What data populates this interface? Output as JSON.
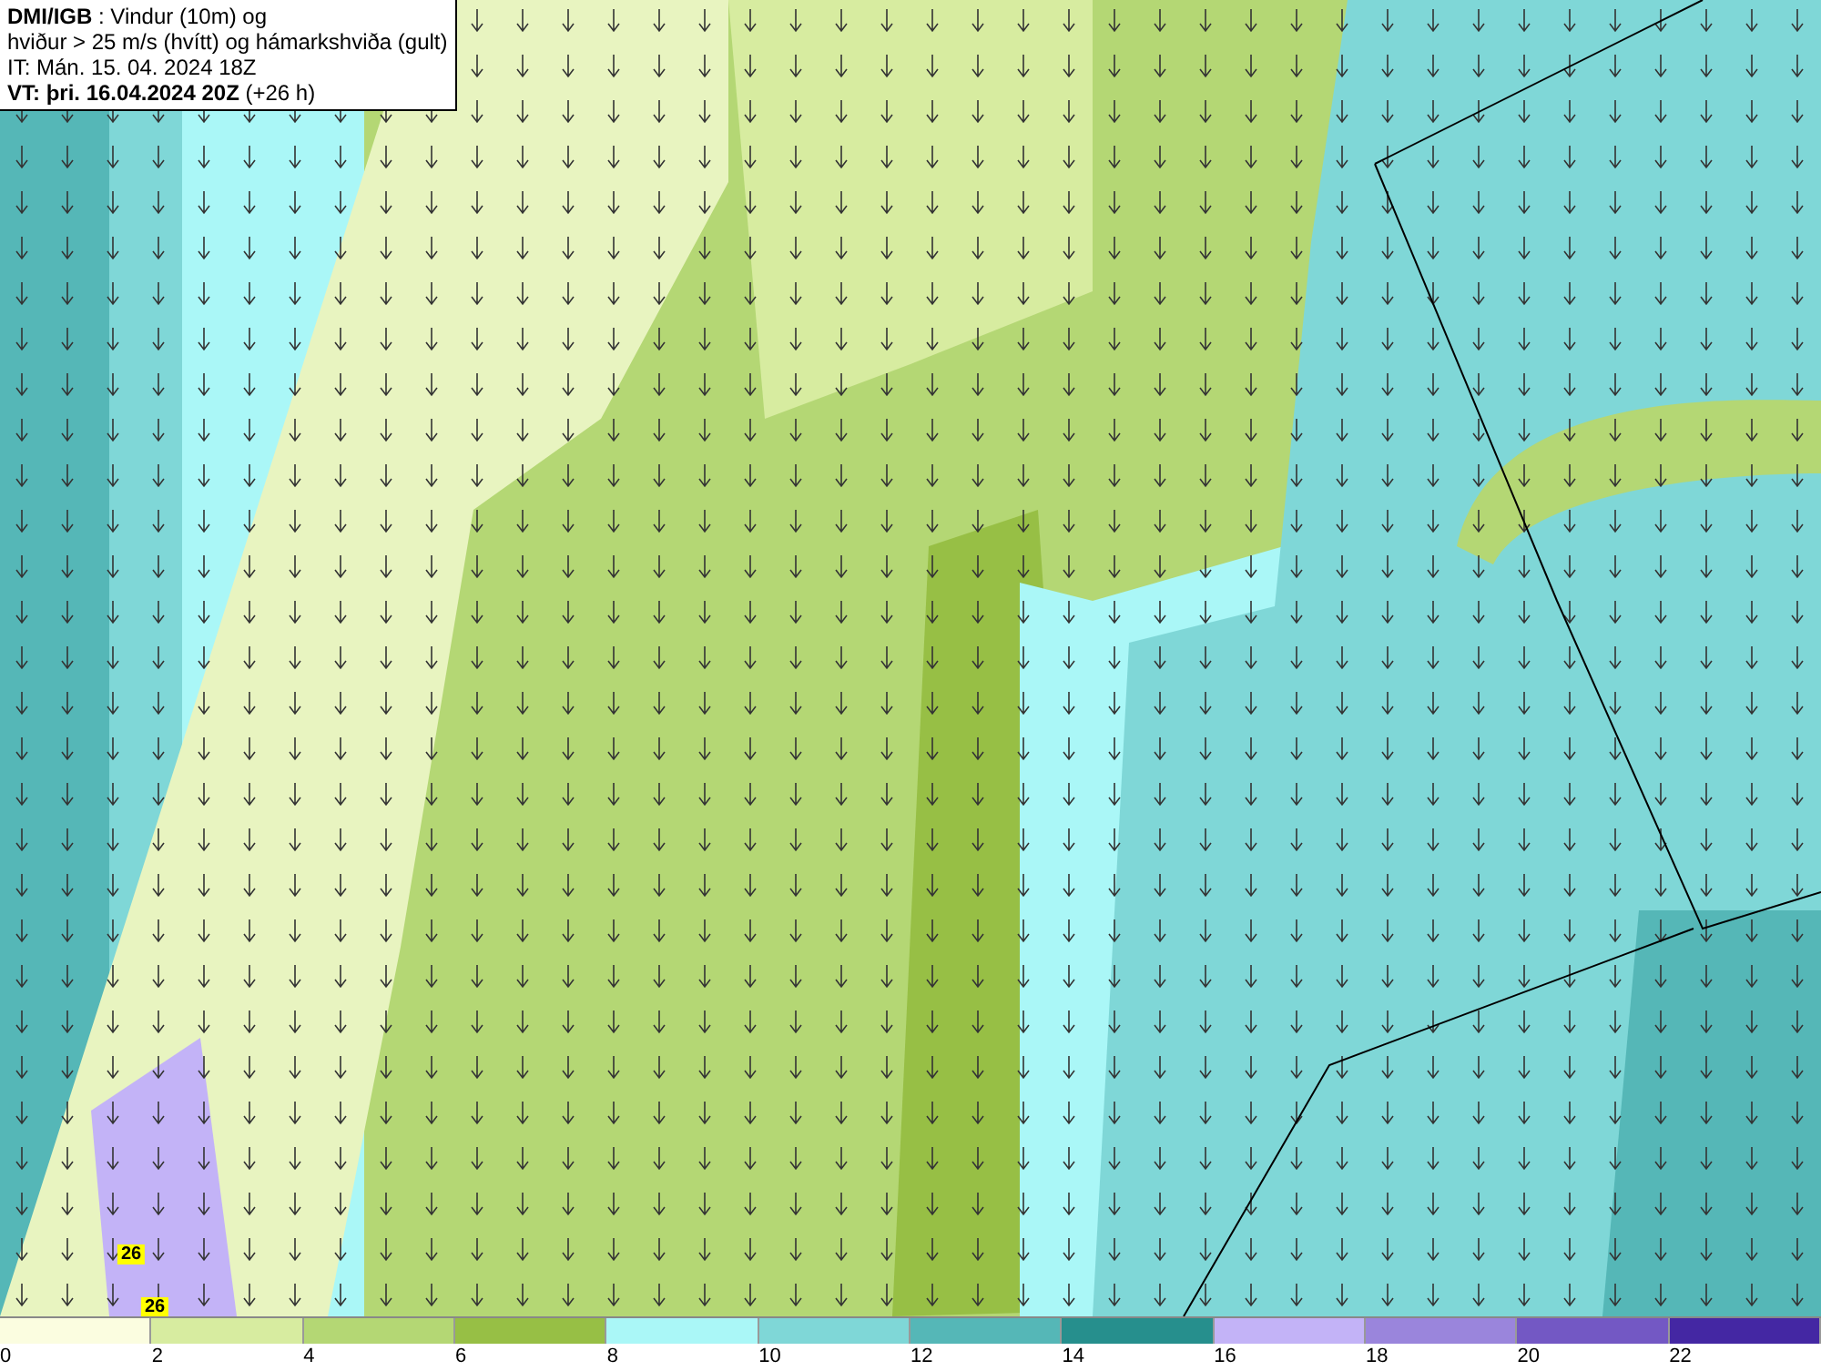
{
  "title_box": {
    "lines": [
      "**DMI/IGB** : Vindur (10m) og",
      "hviður > 25 m/s (hvítt) og hámarkshviða (gult)",
      "IT: Mán. 15. 04. 2024 18Z",
      "**VT: þri. 16.04.2024 20Z** (+26 h)"
    ]
  },
  "map": {
    "gust_labels": [
      "26",
      "26"
    ]
  },
  "legend": {
    "bins": [
      {
        "color": "#fbfde0"
      },
      {
        "color": "#d7eca0"
      },
      {
        "color": "#b4d774"
      },
      {
        "color": "#97bf45"
      },
      {
        "color": "#aaf7f7"
      },
      {
        "color": "#7fd7d7"
      },
      {
        "color": "#55b7b7"
      },
      {
        "color": "#268f8d"
      },
      {
        "color": "#c3b3f7"
      },
      {
        "color": "#9a85dc"
      },
      {
        "color": "#7358c4"
      },
      {
        "color": "#4427a3"
      }
    ],
    "ticks": [
      "0",
      "2",
      "4",
      "6",
      "8",
      "10",
      "12",
      "14",
      "16",
      "18",
      "20",
      "22"
    ]
  }
}
